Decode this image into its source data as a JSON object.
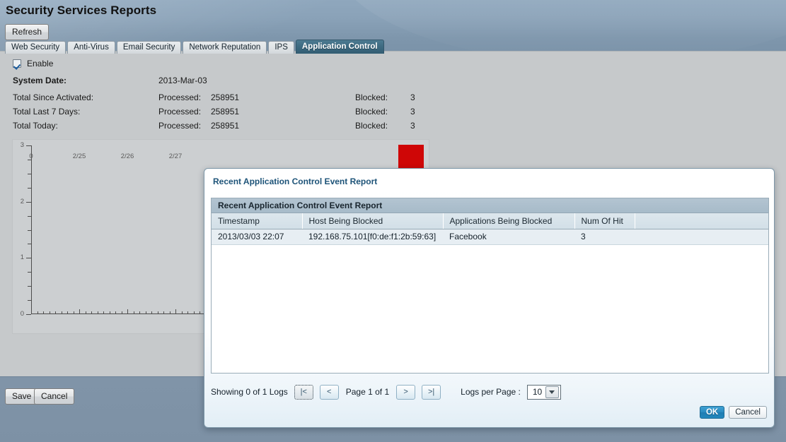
{
  "page": {
    "title": "Security Services Reports",
    "refresh_label": "Refresh"
  },
  "tabs": [
    {
      "label": "Web Security",
      "active": false
    },
    {
      "label": "Anti-Virus",
      "active": false
    },
    {
      "label": "Email Security",
      "active": false
    },
    {
      "label": "Network Reputation",
      "active": false
    },
    {
      "label": "IPS",
      "active": false
    },
    {
      "label": "Application Control",
      "active": true
    }
  ],
  "settings": {
    "enable_label": "Enable",
    "enable_checked": true,
    "system_date_label": "System Date:",
    "system_date_value": "2013-Mar-03"
  },
  "stats": {
    "processed_label": "Processed:",
    "blocked_label": "Blocked:",
    "rows": [
      {
        "label": "Total Since Activated:",
        "processed": "258951",
        "blocked": "3"
      },
      {
        "label": "Total Last 7 Days:",
        "processed": "258951",
        "blocked": "3"
      },
      {
        "label": "Total Today:",
        "processed": "258951",
        "blocked": "3"
      }
    ]
  },
  "chart_data": {
    "type": "bar",
    "title": "",
    "xlabel": "",
    "ylabel": "",
    "categories": [
      "0",
      "2/25",
      "2/26",
      "2/27"
    ],
    "x_tick_labels": [
      "0",
      "2/25",
      "2/26",
      "2/27"
    ],
    "y_tick_labels": [
      "0",
      "1",
      "2",
      "3"
    ],
    "ylim": [
      0,
      3
    ],
    "grid": false,
    "legend": false,
    "series": [
      {
        "name": "Blocked",
        "color": "#cf0606",
        "values": [
          3
        ]
      }
    ],
    "bars": [
      {
        "x_position_fraction": 0.95,
        "value": 3,
        "color": "#cf0606"
      }
    ]
  },
  "page_footer": {
    "save_label": "Save",
    "cancel_label": "Cancel"
  },
  "dialog": {
    "title": "Recent Application Control Event Report",
    "table_caption": "Recent Application Control Event Report",
    "columns": [
      "Timestamp",
      "Host Being Blocked",
      "Applications Being Blocked",
      "Num Of Hit",
      ""
    ],
    "rows": [
      {
        "timestamp": "2013/03/03 22:07",
        "host": "192.168.75.101[f0:de:f1:2b:59:63]",
        "application": "Facebook",
        "hits": "3",
        "pad": ""
      }
    ],
    "pager": {
      "showing": "Showing 0 of 1 Logs",
      "first_label": "|<",
      "prev_label": "<",
      "page_label": "Page 1 of 1",
      "next_label": ">",
      "last_label": ">|",
      "logs_per_page_label": "Logs per Page :",
      "logs_per_page_value": "10"
    },
    "ok_label": "OK",
    "cancel_label": "Cancel"
  }
}
